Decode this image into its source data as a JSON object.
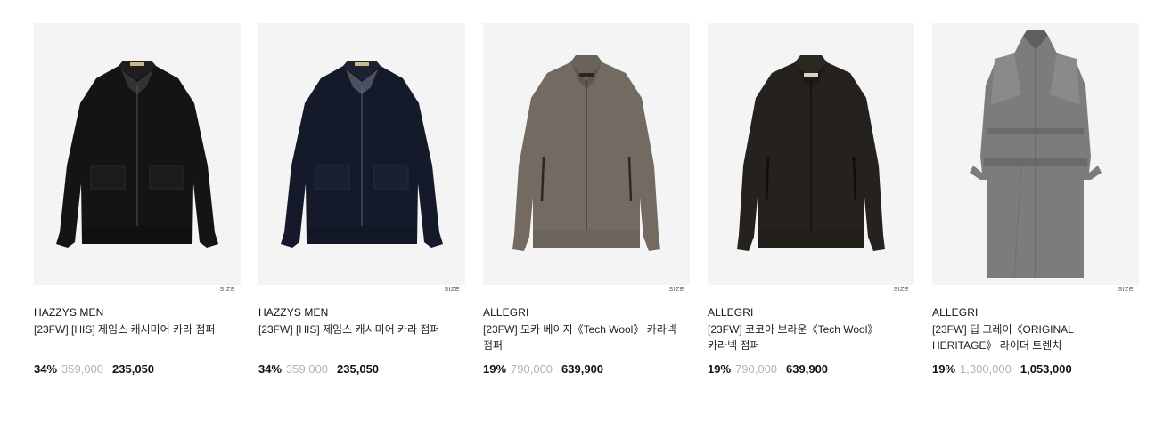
{
  "size_tag": "SIZE",
  "products": [
    {
      "brand": "HAZZYS MEN",
      "name": "[23FW] [HIS] 제임스 캐시미어 카라 점퍼",
      "discount": "34%",
      "original_price": "359,000",
      "price": "235,050",
      "image": "black-collar-jacket-image",
      "jacket_color": "#141414"
    },
    {
      "brand": "HAZZYS MEN",
      "name": "[23FW] [HIS] 제임스 캐시미어 카라 점퍼",
      "discount": "34%",
      "original_price": "359,000",
      "price": "235,050",
      "image": "navy-collar-jacket-image",
      "jacket_color": "#151a2a"
    },
    {
      "brand": "ALLEGRI",
      "name": "[23FW] 모카 베이지《Tech Wool》 카라넥 점퍼",
      "discount": "19%",
      "original_price": "790,000",
      "price": "639,900",
      "image": "mocha-beige-jacket-image",
      "jacket_color": "#736b62"
    },
    {
      "brand": "ALLEGRI",
      "name": "[23FW] 코코아 브라운《Tech Wool》 카라넥 점퍼",
      "discount": "19%",
      "original_price": "790,000",
      "price": "639,900",
      "image": "cocoa-brown-jacket-image",
      "jacket_color": "#25221d"
    },
    {
      "brand": "ALLEGRI",
      "name": "[23FW] 딥 그레이《ORIGINAL HERITAGE》 라이더 트렌치",
      "discount": "19%",
      "original_price": "1,300,000",
      "price": "1,053,000",
      "image": "deep-gray-trench-image",
      "jacket_color": "#7c7c7c"
    }
  ]
}
